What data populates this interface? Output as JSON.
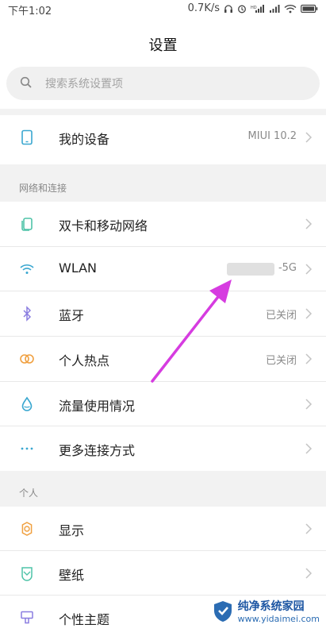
{
  "status_bar": {
    "time": "下午1:02",
    "speed": "0.7K/s"
  },
  "header": {
    "title": "设置"
  },
  "search": {
    "placeholder": "搜索系统设置项"
  },
  "my_device": {
    "label": "我的设备",
    "value": "MIUI 10.2"
  },
  "section_network": {
    "title": "网络和连接"
  },
  "network_items": [
    {
      "label": "双卡和移动网络",
      "value": ""
    },
    {
      "label": "WLAN",
      "value": "-5G"
    },
    {
      "label": "蓝牙",
      "value": "已关闭"
    },
    {
      "label": "个人热点",
      "value": "已关闭"
    },
    {
      "label": "流量使用情况",
      "value": ""
    },
    {
      "label": "更多连接方式",
      "value": ""
    }
  ],
  "section_personal": {
    "title": "个人"
  },
  "personal_items": [
    {
      "label": "显示"
    },
    {
      "label": "壁纸"
    },
    {
      "label": "个性主题"
    }
  ],
  "watermark": {
    "name": "纯净系统家园",
    "url": "www.yidaimei.com"
  },
  "colors": {
    "arrow": "#d63ce0",
    "icon": "#4fc3a8",
    "chevron": "#c4c4c4"
  }
}
